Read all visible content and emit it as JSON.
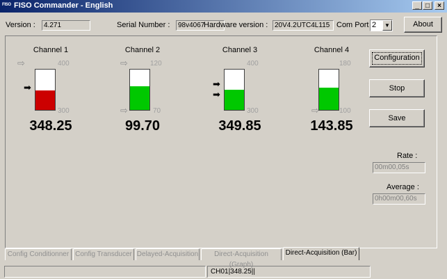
{
  "window": {
    "icon_text": "FISO",
    "title": "FISO Commander - English",
    "minimize": "_",
    "maximize": "□",
    "close": "×"
  },
  "info": {
    "version_label": "Version :",
    "version_value": "4.271",
    "serial_label": "Serial Number :",
    "serial_value": "98v4067",
    "hardware_label": "Hardware version :",
    "hardware_value": "20V4.2UTC4L115",
    "comport_label": "Com Port :",
    "comport_value": "2",
    "about_button": "About"
  },
  "channels": [
    {
      "name": "Channel 1",
      "max": "400",
      "min": "300",
      "reading": "348.25",
      "fill_fraction": 0.48,
      "fill_color": "#cc0000"
    },
    {
      "name": "Channel 2",
      "max": "120",
      "min": "70",
      "reading": "99.70",
      "fill_fraction": 0.59,
      "fill_color": "#00c800"
    },
    {
      "name": "Channel 3",
      "max": "400",
      "min": "300",
      "reading": "349.85",
      "fill_fraction": 0.5,
      "fill_color": "#00c800"
    },
    {
      "name": "Channel 4",
      "max": "180",
      "min": "100",
      "reading": "143.85",
      "fill_fraction": 0.55,
      "fill_color": "#00c800"
    }
  ],
  "sidebar": {
    "configuration_button": "Configuration",
    "stop_button": "Stop",
    "save_button": "Save",
    "rate_label": "Rate :",
    "rate_value": "00m00,05s",
    "average_label": "Average :",
    "average_value": "0h00m00,60s"
  },
  "tabs": [
    {
      "label": "Config Conditionner",
      "active": false
    },
    {
      "label": "Config Transducer",
      "active": false
    },
    {
      "label": "Delayed-Acquisition",
      "active": false
    },
    {
      "label": "Direct-Acquisition (Graph)",
      "active": false
    },
    {
      "label": "Direct-Acquisition (Bar)",
      "active": true
    }
  ],
  "status": {
    "pane2_text": "CH01|348.25||"
  },
  "colors": {
    "alarm": "#cc0000",
    "normal": "#00c800"
  }
}
